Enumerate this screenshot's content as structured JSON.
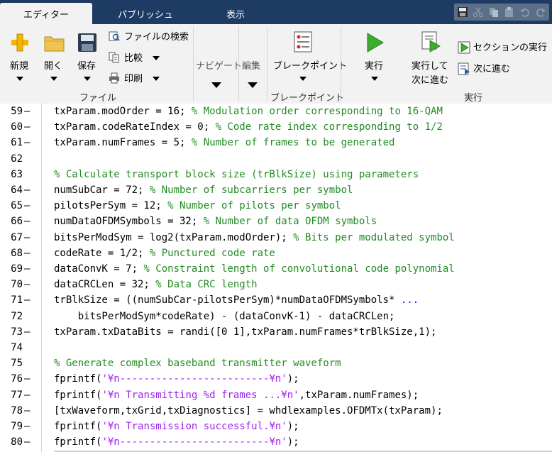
{
  "tabs": [
    {
      "label": "エディター",
      "active": true
    },
    {
      "label": "パブリッシュ",
      "active": false
    },
    {
      "label": "表示",
      "active": false
    }
  ],
  "ribbon": {
    "file_group_label": "ファイル",
    "new_label": "新規",
    "open_label": "開く",
    "save_label": "保存",
    "find_files_label": "ファイルの検索",
    "compare_label": "比較",
    "print_label": "印刷",
    "navigate_label": "ナビゲート",
    "edit_label": "編集",
    "breakpoint_button_label": "ブレークポイント",
    "breakpoint_group_label": "ブレークポイント",
    "run_label": "実行",
    "run_advance_label_1": "実行して",
    "run_advance_label_2": "次に進む",
    "run_section_label": "セクションの実行",
    "advance_label": "次に進む",
    "run_group_label": "実行"
  },
  "editor": {
    "lines": [
      {
        "num": "59",
        "dash": true,
        "parts": [
          {
            "t": "txParam.modOrder = 16; ",
            "c": "k"
          },
          {
            "t": "% Modulation order corresponding to 16-QAM",
            "c": "cm"
          }
        ]
      },
      {
        "num": "60",
        "dash": true,
        "parts": [
          {
            "t": "txParam.codeRateIndex = 0; ",
            "c": "k"
          },
          {
            "t": "% Code rate index corresponding to 1/2",
            "c": "cm"
          }
        ]
      },
      {
        "num": "61",
        "dash": true,
        "parts": [
          {
            "t": "txParam.numFrames = 5; ",
            "c": "k"
          },
          {
            "t": "% Number of frames to be generated",
            "c": "cm"
          }
        ]
      },
      {
        "num": "62",
        "dash": false,
        "parts": []
      },
      {
        "num": "63",
        "dash": false,
        "parts": [
          {
            "t": "% Calculate transport block size (trBlkSize) using parameters",
            "c": "cm"
          }
        ]
      },
      {
        "num": "64",
        "dash": true,
        "parts": [
          {
            "t": "numSubCar = 72; ",
            "c": "k"
          },
          {
            "t": "% Number of subcarriers per symbol",
            "c": "cm"
          }
        ]
      },
      {
        "num": "65",
        "dash": true,
        "parts": [
          {
            "t": "pilotsPerSym = 12; ",
            "c": "k"
          },
          {
            "t": "% Number of pilots per symbol",
            "c": "cm"
          }
        ]
      },
      {
        "num": "66",
        "dash": true,
        "parts": [
          {
            "t": "numDataOFDMSymbols = 32; ",
            "c": "k"
          },
          {
            "t": "% Number of data OFDM symbols",
            "c": "cm"
          }
        ]
      },
      {
        "num": "67",
        "dash": true,
        "parts": [
          {
            "t": "bitsPerModSym = log2(txParam.modOrder); ",
            "c": "k"
          },
          {
            "t": "% Bits per modulated symbol",
            "c": "cm"
          }
        ]
      },
      {
        "num": "68",
        "dash": true,
        "parts": [
          {
            "t": "codeRate = 1/2; ",
            "c": "k"
          },
          {
            "t": "% Punctured code rate",
            "c": "cm"
          }
        ]
      },
      {
        "num": "69",
        "dash": true,
        "parts": [
          {
            "t": "dataConvK = 7; ",
            "c": "k"
          },
          {
            "t": "% Constraint length of convolutional code polynomial",
            "c": "cm"
          }
        ]
      },
      {
        "num": "70",
        "dash": true,
        "parts": [
          {
            "t": "dataCRCLen = 32; ",
            "c": "k"
          },
          {
            "t": "% Data CRC length",
            "c": "cm"
          }
        ]
      },
      {
        "num": "71",
        "dash": true,
        "parts": [
          {
            "t": "trBlkSize = ((numSubCar-pilotsPerSym)*numDataOFDMSymbols* ",
            "c": "k"
          },
          {
            "t": "...",
            "c": "bl"
          }
        ]
      },
      {
        "num": "72",
        "dash": false,
        "parts": [
          {
            "t": "    bitsPerModSym*codeRate) - (dataConvK-1) - dataCRCLen;",
            "c": "k"
          }
        ]
      },
      {
        "num": "73",
        "dash": true,
        "parts": [
          {
            "t": "txParam.txDataBits = randi([0 1],txParam.numFrames*trBlkSize,1);",
            "c": "k"
          }
        ]
      },
      {
        "num": "74",
        "dash": false,
        "parts": []
      },
      {
        "num": "75",
        "dash": false,
        "parts": [
          {
            "t": "% Generate complex baseband transmitter waveform",
            "c": "cm"
          }
        ]
      },
      {
        "num": "76",
        "dash": true,
        "parts": [
          {
            "t": "fprintf(",
            "c": "k"
          },
          {
            "t": "'¥n-------------------------¥n'",
            "c": "st"
          },
          {
            "t": ");",
            "c": "k"
          }
        ]
      },
      {
        "num": "77",
        "dash": true,
        "parts": [
          {
            "t": "fprintf(",
            "c": "k"
          },
          {
            "t": "'¥n Transmitting %d frames ...¥n'",
            "c": "st"
          },
          {
            "t": ",txParam.numFrames);",
            "c": "k"
          }
        ]
      },
      {
        "num": "78",
        "dash": true,
        "parts": [
          {
            "t": "[txWaveform,txGrid,txDiagnostics] = whdlexamples.OFDMTx(txParam);",
            "c": "k"
          }
        ]
      },
      {
        "num": "79",
        "dash": true,
        "parts": [
          {
            "t": "fprintf(",
            "c": "k"
          },
          {
            "t": "'¥n Transmission successful.¥n'",
            "c": "st"
          },
          {
            "t": ");",
            "c": "k"
          }
        ]
      },
      {
        "num": "80",
        "dash": true,
        "parts": [
          {
            "t": "fprintf(",
            "c": "k"
          },
          {
            "t": "'¥n-------------------------¥n'",
            "c": "st"
          },
          {
            "t": ");",
            "c": "k"
          }
        ]
      }
    ]
  },
  "colors": {
    "tabbar": "#1e3c63",
    "ribbon": "#f2f2f2",
    "comment": "#228b22",
    "string": "#a020f0",
    "continuation": "#0000ff"
  }
}
